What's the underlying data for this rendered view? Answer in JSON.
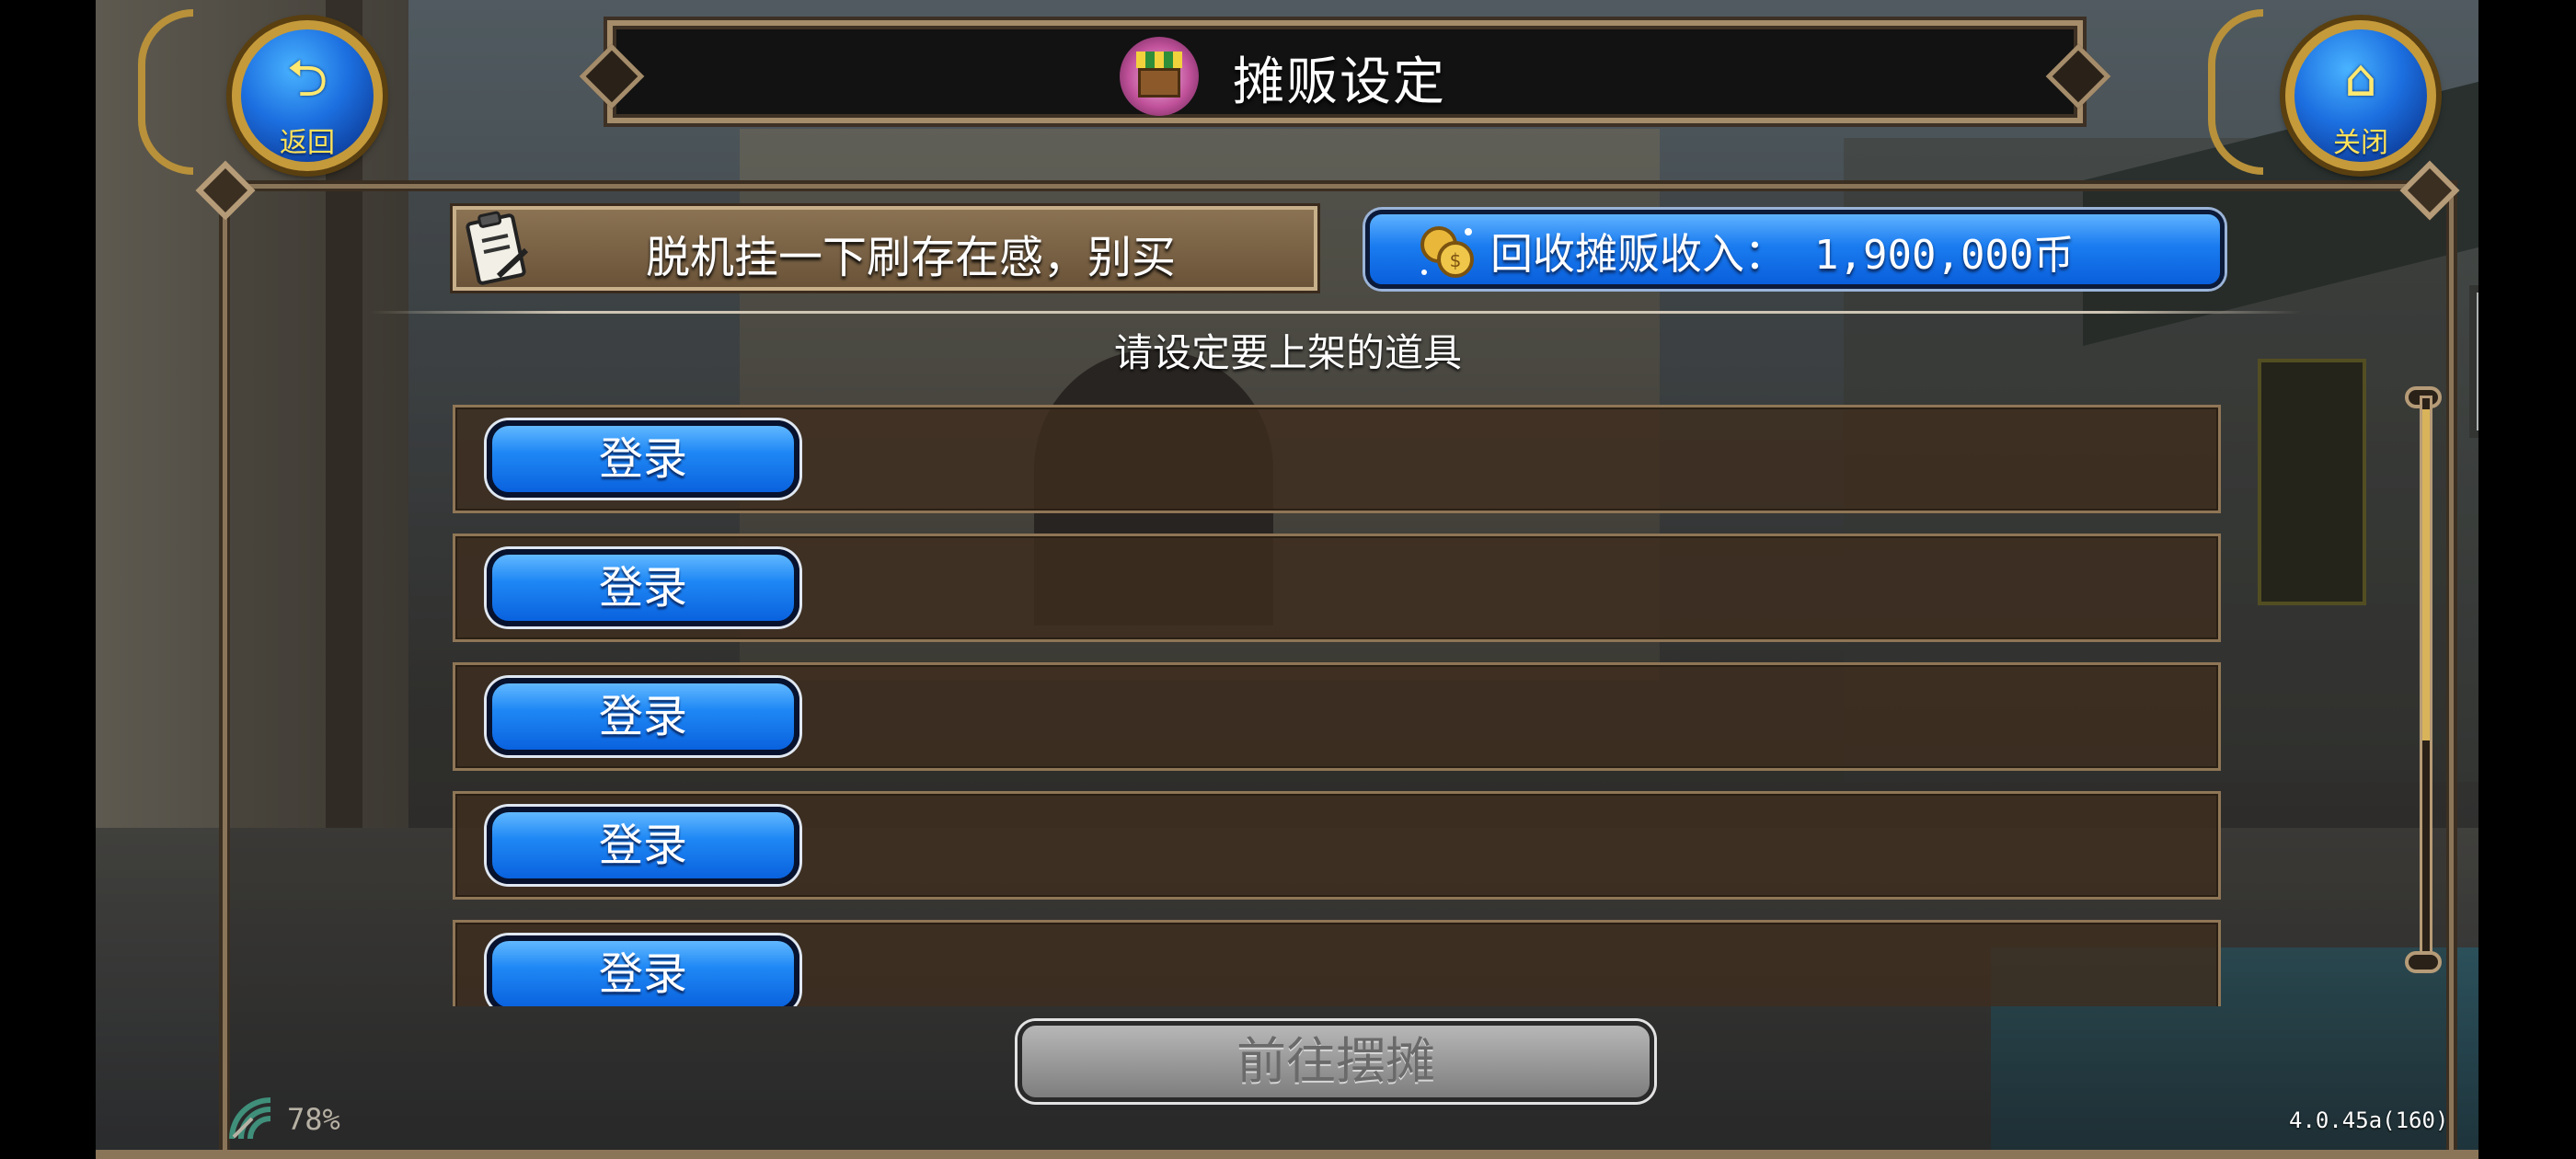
{
  "header": {
    "title": "摊贩设定",
    "back_label": "返回",
    "close_label": "关闭"
  },
  "stall": {
    "name": "脱机挂一下刷存在感，别买",
    "income_label": "回收摊贩收入：",
    "income_amount": "1,900,000币"
  },
  "instruction": "请设定要上架的道具",
  "slots": [
    {
      "button": "登录"
    },
    {
      "button": "登录"
    },
    {
      "button": "登录"
    },
    {
      "button": "登录"
    },
    {
      "button": "登录"
    }
  ],
  "footer": {
    "go_button": "前往摆摊",
    "battery": "78%",
    "version": "4.0.45a(160)"
  },
  "colors": {
    "button_blue": "#1f88f5",
    "panel_border": "#8b7559",
    "disabled_gray": "#9a9a9a",
    "accent_gold": "#c59a3a"
  },
  "icons": {
    "back": "back-arrow-icon",
    "close": "home-icon",
    "title": "shop-stall-icon",
    "stall_name": "clipboard-icon",
    "income": "coins-icon",
    "network": "signal-icon"
  }
}
